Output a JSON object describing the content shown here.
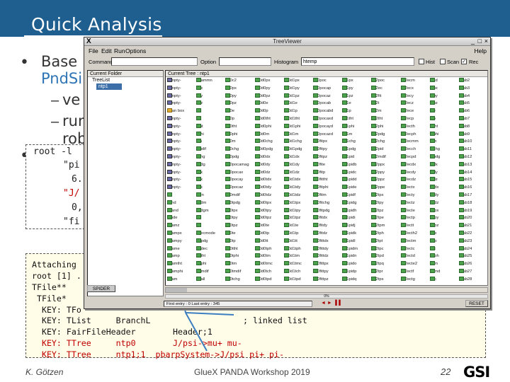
{
  "slide": {
    "title": "Quick Analysis",
    "bullet1_a": "Base",
    "bullet1_b": "PndSi",
    "sub1": "ve",
    "sub2a": "run",
    "sub2b": "rob",
    "code1": [
      "root -l",
      "\"pi",
      "6.",
      "\"J/",
      "0,",
      "\"fi"
    ],
    "code2": [
      "Attaching",
      "root [1] .",
      "TFile**",
      " TFile*",
      "  KEY: TFo",
      "  KEY: TList     BranchL",
      "  KEY: FairFileHeader",
      "  KEY: TTree     ntp0",
      "  KEY: TTree     ntp1;1  pbarpSystem->J/psi pi+ pi-"
    ],
    "code2_extra": {
      "list_tail": "; linked list",
      "header_tail": "Header;1",
      "ntp0_tail": "J/psi->mu+ mu-"
    },
    "footer": {
      "author": "K. Götzen",
      "event": "GlueX PANDA Workshop 2019",
      "page": "22",
      "logo": "GSI"
    }
  },
  "treeviewer": {
    "title": "TreeViewer",
    "menu": [
      "File",
      "Edit",
      "Run",
      "Options"
    ],
    "help": "Help",
    "toolbar": {
      "command_label": "Command",
      "option_label": "Option",
      "histogram_label": "Histogram",
      "histogram_value": "htemp",
      "hist_label": "Hist",
      "scan_label": "Scan",
      "rec_label": "Rec"
    },
    "left_panel": {
      "header": "Current Folder",
      "items": [
        "TreeList",
        "ntp1"
      ]
    },
    "right_panel_header": "Current Tree : ntp1",
    "spider_button": "SPIDER",
    "progress": "0%",
    "status_text": "First entry : 0  Last entry : 345",
    "reset_button": "RESET",
    "columns": [
      [
        "-empty-",
        "-empty-",
        "-empty-",
        "-empty-",
        "Scan box",
        "-empty-",
        "-empty-",
        "-empty-",
        "-empty-",
        "-empty-",
        "-empty-",
        "-empty-",
        "-empty-",
        "-empty-",
        "-empty-",
        "ev",
        "cand",
        "ncand",
        "mode",
        "beamz",
        "beampx",
        "beampy",
        "beame",
        "beamp",
        "beamtht",
        "beamphi",
        "beam"
      ],
      [
        "beammn",
        "xpx",
        "xpy",
        "xpz",
        "xe",
        "xp",
        "xtht",
        "xphi",
        "xm",
        "xmdif",
        "xchg",
        "xpdg",
        "xxx",
        "xyx",
        "xzx",
        "xlen",
        "xpdm",
        "xpdgm",
        "xl",
        "xz",
        "xdecmode",
        "xtrpdg",
        "xtrdec",
        "xtrtht",
        "xtrphi",
        "xtrmdif",
        "xtrall"
      ],
      [
        "xd0c2",
        "xd0px",
        "xd0py",
        "xd0pz",
        "xd0e",
        "xd0p",
        "xd0tht",
        "xd0phi",
        "xd0m",
        "xd0chg",
        "xd0pdg",
        "xd0pocamag",
        "xd0pocax",
        "xd0pocay",
        "xd0pocaz",
        "xd0mdif",
        "xd0tpdg",
        "xd0tpx",
        "xd0tpy",
        "xd0tpz",
        "xd0te",
        "xd0tp",
        "xd0ttht",
        "xd0tphi",
        "xd0tm",
        "xd0tmdif",
        "xd0tchg"
      ],
      [
        "xd0d0px",
        "xd0d0py",
        "xd0d0pz",
        "xd0d0e",
        "xd0d0p",
        "xd0d0tht",
        "xd0d0phi",
        "xd0d0m",
        "xd0d0chg",
        "xd0d0pdg",
        "xd0d0dx",
        "xd0d0dy",
        "xd0d0dz",
        "xd0d0tdx",
        "xd0d0tdy",
        "xd0d0tdz",
        "xd0d0tpx",
        "xd0d0tpy",
        "xd0d0tpz",
        "xd0d0te",
        "xd0d0tp",
        "xd0d0tt",
        "xd0d0tph",
        "xd0d0tm",
        "xd0d0tmc",
        "xd0d0tch",
        "xd0d0tpd"
      ],
      [
        "xd0d1px",
        "xd0d1py",
        "xd0d1pz",
        "xd0d1e",
        "xd0d1p",
        "xd0d1tht",
        "xd0d1phi",
        "xd0d1m",
        "xd0d1chg",
        "xd0d1pdg",
        "xd0d1dx",
        "xd0d1dy",
        "xd0d1dz",
        "xd0d1tdx",
        "xd0d1tdy",
        "xd0d1tdz",
        "xd0d1tpx",
        "xd0d1tpy",
        "xd0d1tpz",
        "xd0d1te",
        "xd0d1tp",
        "xd0d1tt",
        "xd0d1tph",
        "xd0d1tm",
        "xd0d1tmc",
        "xd0d1tch",
        "xd0d1tpd"
      ],
      [
        "xd0poc",
        "xd0pocap",
        "xd0pocaz",
        "xd0pocab",
        "xd0pocabd",
        "xd0pocaxd",
        "xd0pocayd",
        "xd0pocazd",
        "xd0fitpx",
        "xd0fitpy",
        "xd0fitpz",
        "xd0fite",
        "xd0fitp",
        "xd0fittht",
        "xd0fitphi",
        "xd0fitm",
        "xd0fitchg",
        "xd0fitpdg",
        "xd0fitdx",
        "xd0fitdy",
        "xd0fitdz",
        "xd0fittdx",
        "xd0fittdy",
        "xd0fittdz",
        "xd0fittpx",
        "xd0fittpy",
        "xd0fittpz"
      ],
      [
        "xd1px",
        "xd1py",
        "xd1pz",
        "xd1e",
        "xd1p",
        "xd1tht",
        "xd1phi",
        "xd1m",
        "xd1chg",
        "xd1pdg",
        "xd1pid",
        "xd1pidb",
        "xd1pidc",
        "xd1pidd",
        "xd1pide",
        "xd1pidf",
        "xd1pidg",
        "xd1pidh",
        "xd1pidi",
        "xd1pidj",
        "xd1pidk",
        "xd1pidl",
        "xd1pidm",
        "xd1pidn",
        "xd1pido",
        "xd1pidp",
        "xd1pidq"
      ],
      [
        "xd2poc",
        "xd2ec",
        "xd2fit",
        "xd2t",
        "xd2m",
        "xd2tht",
        "xd2phi",
        "xd2pdg",
        "xd2chg",
        "xd2pid",
        "xd2mdif",
        "xd2ppx",
        "xd2ppy",
        "xd2ppz",
        "xd2ppe",
        "xd2tpx",
        "xd2tpy",
        "xd2tpz",
        "xd2tpe",
        "xd2tpm",
        "xd2tph",
        "xd2tpt",
        "xd2tpc",
        "xd2tpd",
        "xd2tpq",
        "xd2tpr",
        "xd2tps"
      ],
      [
        "xd2ecm",
        "xd2ecx",
        "xd2ecy",
        "xd2ecz",
        "xd2ece",
        "xd2ecp",
        "xd2ecth",
        "xd2ecph",
        "xd2ecmm",
        "xd2ecch",
        "xd2ecpd",
        "xd2ecdx",
        "xd2ecdy",
        "xd2ecdz",
        "xd2ectx",
        "xd2ecty",
        "xd2ectz",
        "xd2ecte",
        "xd2ectp",
        "xd2ectt",
        "xd2ecth2",
        "xd2ectm",
        "xd2ectc",
        "xd2ectd",
        "xd2ecte2",
        "xd2ectf",
        "xd2ectg"
      ],
      [
        "t2sd",
        "t2px",
        "t2py",
        "t2pz",
        "t2e",
        "t2p",
        "t2tht",
        "t2phi",
        "t2m",
        "t2chg",
        "t2pdg",
        "t2dx",
        "t2dy",
        "t2dz",
        "t2tdx",
        "t2tdy",
        "t2tdz",
        "t2tpx",
        "t2tpy",
        "t2tpz",
        "t2te",
        "t2tp",
        "t2tt",
        "t2tph",
        "t2tm",
        "t2tmd",
        "t2tc"
      ],
      [
        "fillab2",
        "fillab3",
        "fillab4",
        "fillab5",
        "fillab6",
        "fillab7",
        "fillab8",
        "fillab9",
        "fillab10",
        "fillab11",
        "fillab12",
        "fillab13",
        "fillab14",
        "fillab15",
        "fillab16",
        "fillab17",
        "fillab18",
        "fillab19",
        "fillab20",
        "fillab21",
        "fillab22",
        "fillab23",
        "fillab24",
        "fillab25",
        "fillab26",
        "fillab27",
        "fillab28"
      ]
    ]
  }
}
